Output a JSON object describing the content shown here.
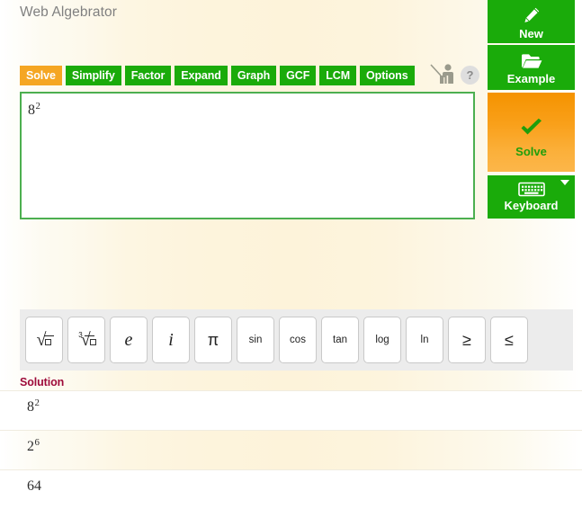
{
  "app": {
    "title": "Web Algebrator"
  },
  "tabs": [
    {
      "label": "Solve",
      "name": "tab-solve",
      "active": true
    },
    {
      "label": "Simplify",
      "name": "tab-simplify",
      "active": false
    },
    {
      "label": "Factor",
      "name": "tab-factor",
      "active": false
    },
    {
      "label": "Expand",
      "name": "tab-expand",
      "active": false
    },
    {
      "label": "Graph",
      "name": "tab-graph",
      "active": false
    },
    {
      "label": "GCF",
      "name": "tab-gcf",
      "active": false
    },
    {
      "label": "LCM",
      "name": "tab-lcm",
      "active": false
    },
    {
      "label": "Options",
      "name": "tab-options",
      "active": false
    }
  ],
  "header_icons": {
    "teacher_icon": "teacher-icon",
    "help_label": "?"
  },
  "input": {
    "base": "8",
    "exponent": "2"
  },
  "sidebar": {
    "new_label": "New",
    "new_icon": "pencil-icon",
    "example_label": "Example",
    "example_icon": "folder-open-icon",
    "solve_label": "Solve",
    "solve_icon": "checkmark-icon",
    "keyboard_label": "Keyboard",
    "keyboard_icon": "keyboard-icon",
    "keyboard_caret": "caret-down-icon"
  },
  "symbols": [
    {
      "name": "sqrt",
      "display": "√□",
      "kind": "radical2"
    },
    {
      "name": "cbrt",
      "display": "∛□",
      "kind": "radical3"
    },
    {
      "name": "euler-e",
      "display": "e",
      "kind": "ital"
    },
    {
      "name": "imaginary-i",
      "display": "i",
      "kind": "ital"
    },
    {
      "name": "pi",
      "display": "π",
      "kind": "big"
    },
    {
      "name": "sin",
      "display": "sin",
      "kind": "word"
    },
    {
      "name": "cos",
      "display": "cos",
      "kind": "word"
    },
    {
      "name": "tan",
      "display": "tan",
      "kind": "word"
    },
    {
      "name": "log",
      "display": "log",
      "kind": "word"
    },
    {
      "name": "ln",
      "display": "ln",
      "kind": "word"
    },
    {
      "name": "greater-equal",
      "display": "≥",
      "kind": "big"
    },
    {
      "name": "less-equal",
      "display": "≤",
      "kind": "big"
    }
  ],
  "solution": {
    "heading": "Solution",
    "steps": [
      {
        "base": "8",
        "exponent": "2"
      },
      {
        "base": "2",
        "exponent": "6"
      },
      {
        "base": "64",
        "exponent": ""
      }
    ]
  },
  "colors": {
    "tab_green": "#1aab0a",
    "tab_active_orange": "#f5a623",
    "input_border_green": "#4caf50",
    "solve_orange": "#f9a01a",
    "solve_text_green": "#1f9e0b",
    "solution_heading": "#9e0b3a",
    "page_cream": "#fdf3da"
  }
}
